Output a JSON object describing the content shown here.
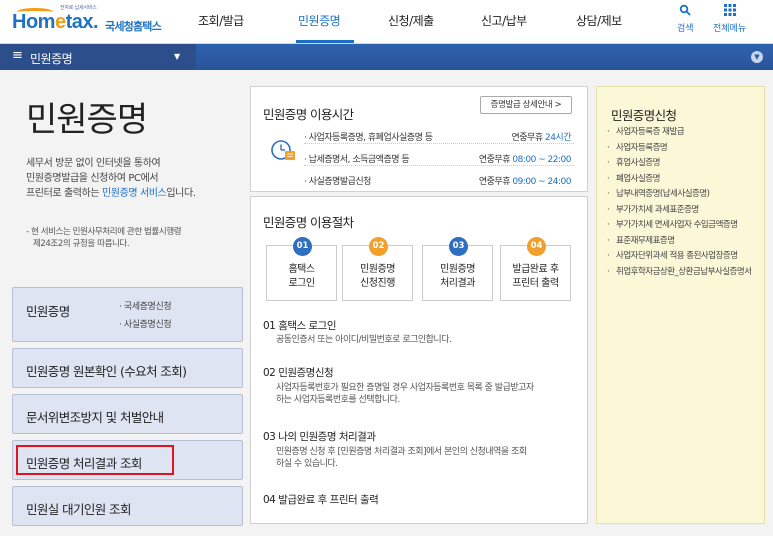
{
  "header": {
    "logo_tagline": "전자로 납세서비스",
    "logo_text_hom": "Hom",
    "logo_text_e": "e",
    "logo_text_tax": "tax.",
    "logo_korean": "국세청홈택스",
    "nav": [
      "조회/발급",
      "민원증명",
      "신청/제출",
      "신고/납부",
      "상담/제보"
    ],
    "active_nav": "민원증명",
    "search_label": "검색",
    "allmenu_label": "전체메뉴"
  },
  "menubar": {
    "current": "민원증명"
  },
  "left": {
    "title": "민원증명",
    "desc_line1": "세무서 방문 없이 인터넷을 통하여",
    "desc_line2": "민원증명발급을 신청하여 PC에서",
    "desc_line3_pre": "프린터로 출력하는 ",
    "desc_line3_hl": "민원증명 서비스",
    "desc_line3_post": "입니다.",
    "note_line1": "- 현 서비스는 민원사무처리에 관한 법률시행령",
    "note_line2": "제24조2의 규정을 따릅니다.",
    "menus": [
      {
        "title": "민원증명",
        "subs": [
          "· 국세증명신청",
          "· 사실증명신청"
        ]
      },
      {
        "title": "민원증명 원본확인 (수요처 조회)"
      },
      {
        "title": "문서위변조방지 및 처벌안내"
      },
      {
        "title": "민원증명 처리결과 조회"
      },
      {
        "title": "민원실 대기인원 조회"
      }
    ]
  },
  "hours": {
    "title": "민원증명 이용시간",
    "detail_button": "증명발급 상세안내 >",
    "rows": [
      {
        "label": "· 사업자등록증명, 휴폐업사실증명 등",
        "days": "연중무휴 ",
        "time": "24시간"
      },
      {
        "label": "· 납세증명서, 소득금액증명 등",
        "days": "연중무휴 ",
        "time": "08:00 ~ 22:00"
      },
      {
        "label": "· 사실증명발급신청",
        "days": "연중무휴 ",
        "time": "09:00 ~ 24:00"
      }
    ]
  },
  "procedure": {
    "title": "민원증명 이용절차",
    "steps": [
      {
        "num": "01",
        "line1": "홈택스",
        "line2": "로그인"
      },
      {
        "num": "02",
        "line1": "민원증명",
        "line2": "신청진행"
      },
      {
        "num": "03",
        "line1": "민원증명",
        "line2": "처리결과"
      },
      {
        "num": "04",
        "line1": "발급완료 후",
        "line2": "프린터 출력"
      }
    ],
    "details": [
      {
        "heading": "01 홈택스 로그인",
        "text1": "공동인증서 또는 아이디/비밀번호로 로그인합니다.",
        "text2": ""
      },
      {
        "heading": "02 민원증명신청",
        "text1": "사업자등록번호가 필요한 증명일 경우 사업자등록번호 목록 중 발급받고자",
        "text2": "하는 사업자등록번호를 선택합니다."
      },
      {
        "heading": "03 나의 민원증명 처리결과",
        "text1": "민원증명 신청 후 [민원증명 처리결과 조회]에서 본인의 신청내역을 조회",
        "text2": "하실 수 있습니다."
      },
      {
        "heading": "04 발급완료 후 프린터 출력",
        "text1": "",
        "text2": ""
      }
    ]
  },
  "right": {
    "title": "민원증명신청",
    "items": [
      "사업자등록증 재발급",
      "사업자등록증명",
      "휴업사실증명",
      "폐업사실증명",
      "납부내역증명(납세사실증명)",
      "부가가치세 과세표준증명",
      "부가가치세 면세사업자 수입금액증명",
      "표준재무제표증명",
      "사업자단위과세 적용 종된사업장증명",
      "취업후학자금상환_상환금납부사실증명서"
    ]
  },
  "colors": {
    "brand_blue": "#1b6fc6",
    "menubar": "#2c5aa0",
    "highlight_red": "#e0141e",
    "step_blue": "#2f6fc0",
    "step_orange": "#f0a02b",
    "panel_yellow": "#fbf8d8"
  },
  "icons": {
    "search": "search-icon",
    "allmenu": "grid-icon",
    "hamburger": "hamburger-icon",
    "clock": "clock-icon"
  }
}
